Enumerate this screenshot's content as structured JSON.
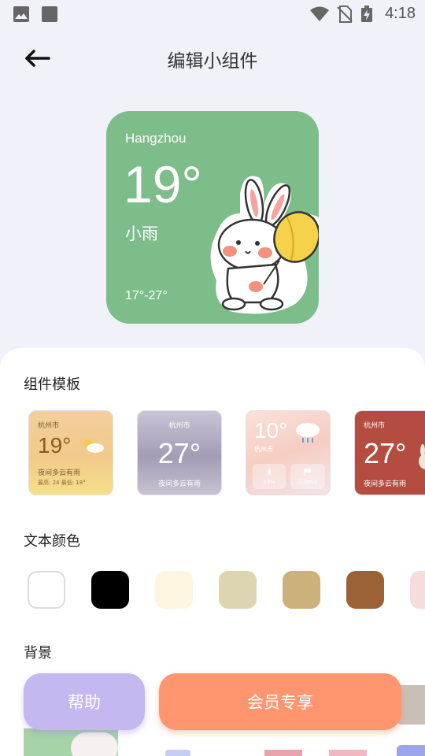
{
  "status_bar": {
    "time": "4:18"
  },
  "header": {
    "title": "编辑小组件"
  },
  "preview": {
    "city": "Hangzhou",
    "temperature": "19°",
    "condition": "小雨",
    "range": "17°-27°",
    "background_color": "#7dbd8a"
  },
  "sections": {
    "templates_title": "组件模板",
    "text_color_title": "文本颜色",
    "background_title": "背景"
  },
  "templates": [
    {
      "city": "杭州市",
      "temp": "19°",
      "desc": "夜间多云有雨",
      "extra": "最高: 24 最低: 18°"
    },
    {
      "city": "杭州市",
      "temp": "27°",
      "desc": "夜间多云有雨"
    },
    {
      "temp": "10°",
      "city": "杭州市",
      "humidity": "23%",
      "wind": "2.3m/s"
    },
    {
      "city": "杭州市",
      "temp": "27°",
      "desc": "夜间多云有雨"
    }
  ],
  "text_colors": [
    "#ffffff",
    "#000000",
    "#fdf6de",
    "#ddd5b1",
    "#ccb17a",
    "#9a6235",
    "#f6dcdc"
  ],
  "buttons": {
    "help": "帮助",
    "vip": "会员专享"
  }
}
